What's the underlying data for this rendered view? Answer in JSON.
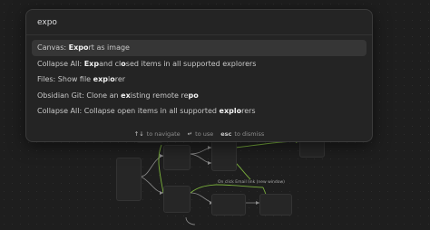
{
  "search": {
    "query": "expo"
  },
  "results": [
    {
      "selected": true,
      "segments": [
        {
          "t": "Canvas: ",
          "m": false
        },
        {
          "t": "Expo",
          "m": true
        },
        {
          "t": "rt as image",
          "m": false
        }
      ]
    },
    {
      "selected": false,
      "segments": [
        {
          "t": "Collapse All: ",
          "m": false
        },
        {
          "t": "Exp",
          "m": true
        },
        {
          "t": "and cl",
          "m": false
        },
        {
          "t": "o",
          "m": true
        },
        {
          "t": "sed items in all supported explorers",
          "m": false
        }
      ]
    },
    {
      "selected": false,
      "segments": [
        {
          "t": "Files: Show file ",
          "m": false
        },
        {
          "t": "exp",
          "m": true
        },
        {
          "t": "l",
          "m": false
        },
        {
          "t": "o",
          "m": true
        },
        {
          "t": "rer",
          "m": false
        }
      ]
    },
    {
      "selected": false,
      "segments": [
        {
          "t": "Obsidian Git: Clone an ",
          "m": false
        },
        {
          "t": "ex",
          "m": true
        },
        {
          "t": "isting remote re",
          "m": false
        },
        {
          "t": "po",
          "m": true
        }
      ]
    },
    {
      "selected": false,
      "segments": [
        {
          "t": "Collapse All: Collapse open items in all supported ",
          "m": false
        },
        {
          "t": "explo",
          "m": true
        },
        {
          "t": "rers",
          "m": false
        }
      ]
    }
  ],
  "instructions": [
    {
      "key": "↑↓",
      "label": "to navigate",
      "bold": false
    },
    {
      "key": "↵",
      "label": "to use",
      "bold": false
    },
    {
      "key": "esc",
      "label": "to dismiss",
      "bold": true
    }
  ],
  "canvas": {
    "float_label": "On click Email link (new window)",
    "accent_color": "#7ab03c",
    "line_color": "#8a8a8a"
  }
}
